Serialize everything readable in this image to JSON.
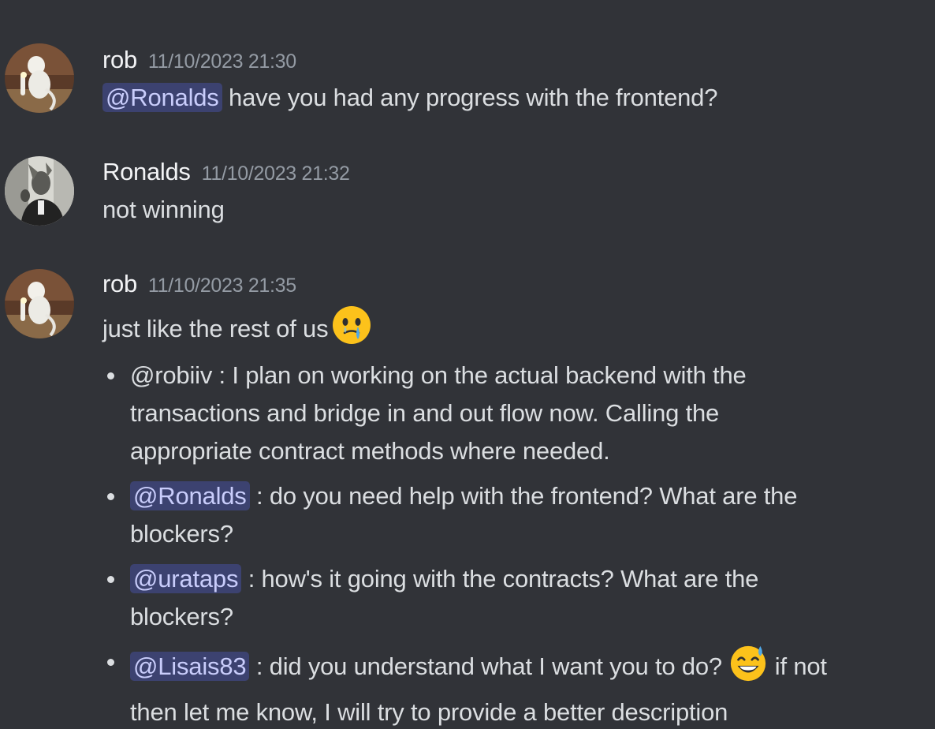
{
  "messages": [
    {
      "author": "rob",
      "timestamp": "11/10/2023 21:30",
      "mention": "@Ronalds",
      "text": " have you had any progress with the frontend?"
    },
    {
      "author": "Ronalds",
      "timestamp": "11/10/2023 21:32",
      "text": "not winning"
    },
    {
      "author": "rob",
      "timestamp": "11/10/2023 21:35",
      "text": "just like the rest of us",
      "emoji": "face-holding-back-tears",
      "bullets": [
        {
          "line1": "@robiiv : I plan on working on the actual backend with the",
          "line2": "transactions and bridge in and out flow now. Calling the",
          "line3": "appropriate contract methods where needed."
        },
        {
          "mention": "@Ronalds",
          "line1": " : do you need help with the frontend? What are the",
          "line2": "blockers?"
        },
        {
          "mention": "@urataps",
          "line1": " : how's it going with the contracts? What are the",
          "line2": "blockers?"
        },
        {
          "mention": "@Lisais83",
          "line1a": " : did you understand what I want you to do? ",
          "emoji": "grinning-face-with-sweat",
          "line1b": " if not",
          "line2": "then let me know, I will try to provide a better description"
        }
      ]
    }
  ],
  "colors": {
    "background": "#313338",
    "text": "#dbdee1",
    "username": "#f2f3f5",
    "timestamp": "#949ba4",
    "mention_bg": "#3c4270",
    "mention_text": "#c9cdfb"
  }
}
